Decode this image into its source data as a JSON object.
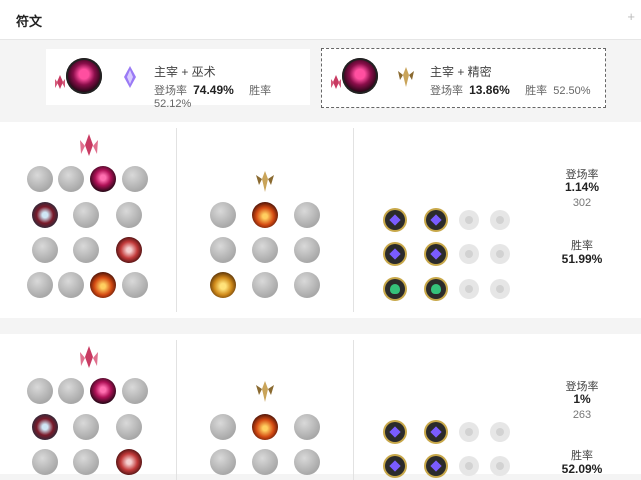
{
  "header": {
    "title": "符文",
    "plus": "+"
  },
  "summary": [
    {
      "name": "主宰 + 巫术",
      "pick_label": "登场率",
      "pick_rate": "74.49%",
      "win_label": "胜率",
      "win_rate": "52.12%",
      "secondary_tree_icon": "sorcery-icon"
    },
    {
      "name": "主宰 + 精密",
      "pick_label": "登场率",
      "pick_rate": "13.86%",
      "win_label": "胜率",
      "win_rate": "52.50%",
      "secondary_tree_icon": "precision-icon"
    }
  ],
  "builds": [
    {
      "pick_label": "登场率",
      "pick_rate": "1.14%",
      "games": "302",
      "win_label": "胜率",
      "win_rate": "51.99%"
    },
    {
      "pick_label": "登场率",
      "pick_rate": "1%",
      "games": "263",
      "win_label": "胜率",
      "win_rate": "52.09%"
    }
  ]
}
